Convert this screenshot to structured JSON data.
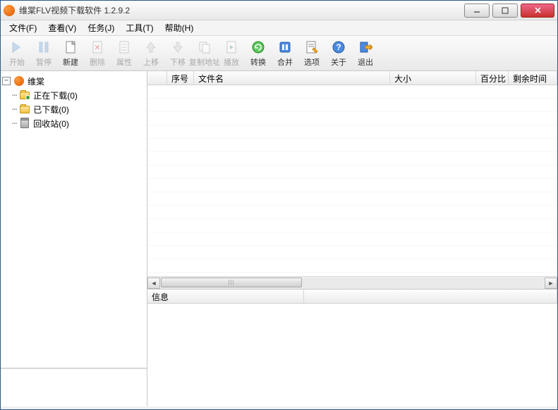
{
  "window": {
    "title": "维棠FLV视频下载软件 1.2.9.2"
  },
  "menubar": {
    "file": "文件(F)",
    "view": "查看(V)",
    "task": "任务(J)",
    "tools": "工具(T)",
    "help": "帮助(H)"
  },
  "toolbar": {
    "start": "开始",
    "pause": "暂停",
    "new": "新建",
    "delete": "删除",
    "props": "属性",
    "moveup": "上移",
    "movedown": "下移",
    "copyurl": "复制地址",
    "play": "播放",
    "convert": "转换",
    "merge": "合并",
    "options": "选项",
    "about": "关于",
    "exit": "退出"
  },
  "tree": {
    "root": "维棠",
    "downloading": "正在下载(0)",
    "downloaded": "已下载(0)",
    "recycle": "回收站(0)"
  },
  "list_columns": {
    "blank": "",
    "seq": "序号",
    "filename": "文件名",
    "size": "大小",
    "percent": "百分比",
    "remaining": "剩余时间"
  },
  "info_columns": {
    "info": "信息",
    "blank": ""
  },
  "icon_colors": {
    "convert": "#4ab54a",
    "merge": "#3a7bd5",
    "options": "#f0a030",
    "about": "#3a7bd5",
    "exit": "#f0a030"
  }
}
